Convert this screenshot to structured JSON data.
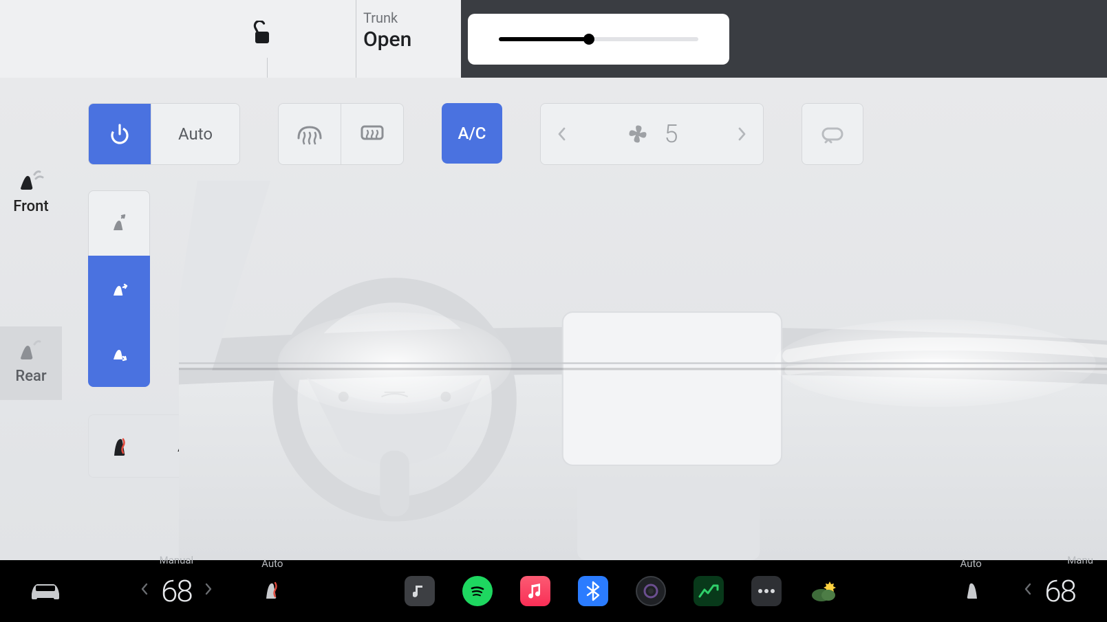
{
  "topbar": {
    "trunk_label": "Trunk",
    "trunk_status": "Open",
    "slider_percent": 45
  },
  "rail": {
    "front_label": "Front",
    "rear_label": "Rear"
  },
  "climate": {
    "power_on": true,
    "auto_label": "Auto",
    "ac_label": "A/C",
    "ac_on": true,
    "fan_speed": "5",
    "airflow": {
      "face": false,
      "body": true,
      "feet": true
    },
    "seat_auto_label": "Auto"
  },
  "dock": {
    "left_mode": "Manual",
    "left_temp": "68",
    "left_seat_mode": "Auto",
    "right_seat_mode": "Auto",
    "right_mode": "Manu",
    "right_temp": "68"
  }
}
